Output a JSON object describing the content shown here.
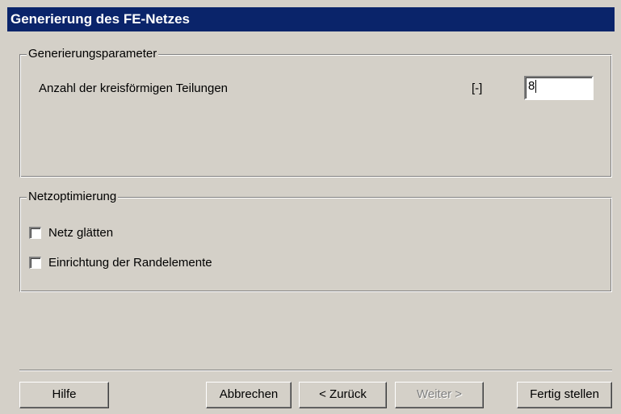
{
  "window": {
    "title": "Generierung des FE-Netzes"
  },
  "generation_params": {
    "legend": "Generierungsparameter",
    "divisions_label": "Anzahl der kreisförmigen Teilungen",
    "divisions_unit": "[-]",
    "divisions_value": "8"
  },
  "mesh_optimization": {
    "legend": "Netzoptimierung",
    "options": [
      {
        "label": "Netz glätten",
        "checked": false
      },
      {
        "label": "Einrichtung der Randelemente",
        "checked": false
      }
    ]
  },
  "buttons": {
    "help": "Hilfe",
    "cancel": "Abbrechen",
    "back": "< Zurück",
    "next": "Weiter >",
    "finish": "Fertig stellen"
  }
}
